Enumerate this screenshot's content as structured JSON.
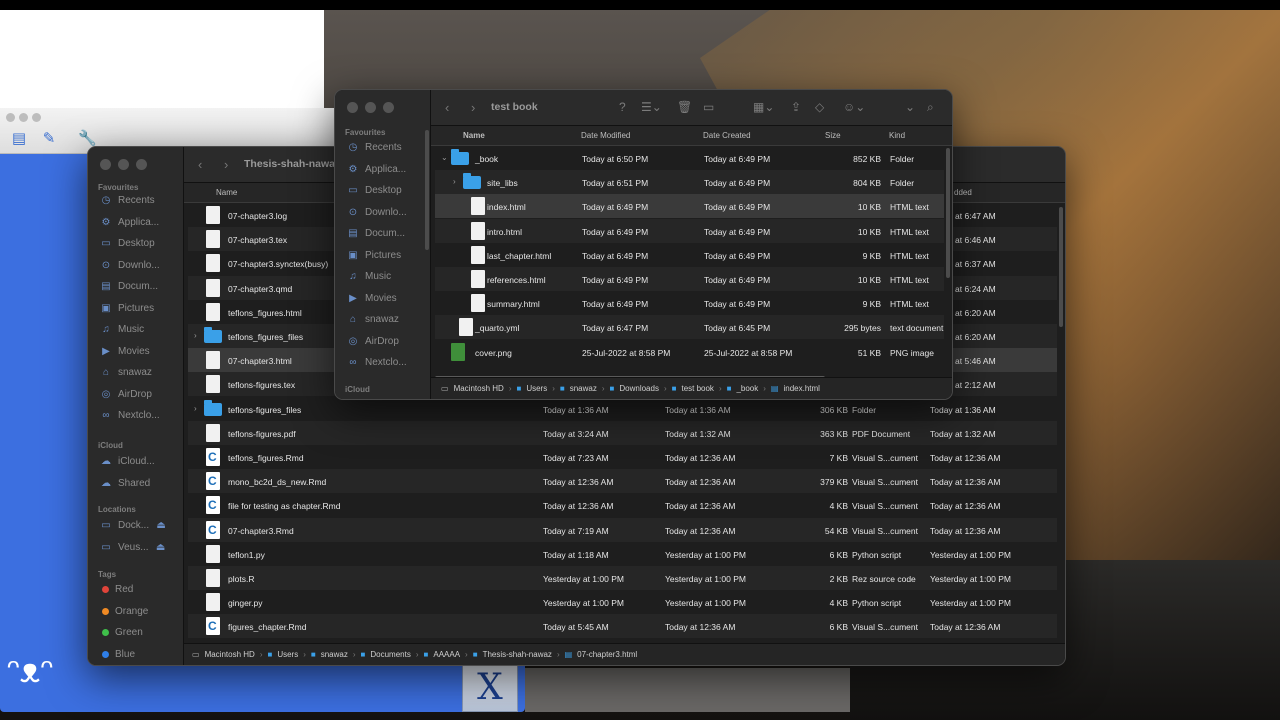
{
  "back_window": {
    "title": "Thesis-shah-nawaz",
    "columns": {
      "name": "Name",
      "date_added": "dded"
    },
    "sidebar": {
      "favourites_label": "Favourites",
      "favourites": [
        "Recents",
        "Applica...",
        "Desktop",
        "Downlo...",
        "Docum...",
        "Pictures",
        "Music",
        "Movies",
        "snawaz",
        "AirDrop",
        "Nextclo..."
      ],
      "icloud_label": "iCloud",
      "icloud": [
        "iCloud...",
        "Shared"
      ],
      "locations_label": "Locations",
      "locations": [
        "Dock...",
        "Veus..."
      ],
      "tags_label": "Tags",
      "tags": [
        {
          "name": "Red",
          "color": "#e0443a"
        },
        {
          "name": "Orange",
          "color": "#f08a24"
        },
        {
          "name": "Green",
          "color": "#3fbf4a"
        },
        {
          "name": "Blue",
          "color": "#2f7fe8"
        }
      ]
    },
    "rows": [
      {
        "name": "07-chapter3.log",
        "modified": "",
        "created": "",
        "size": "",
        "kind": "",
        "added": "Today at 6:47 AM",
        "icon": "doc"
      },
      {
        "name": "07-chapter3.tex",
        "modified": "",
        "created": "",
        "size": "",
        "kind": "",
        "added": "Today at 6:46 AM",
        "icon": "doc"
      },
      {
        "name": "07-chapter3.synctex(busy)",
        "modified": "",
        "created": "",
        "size": "",
        "kind": "",
        "added": "Today at 6:37 AM",
        "icon": "doc"
      },
      {
        "name": "07-chapter3.qmd",
        "modified": "",
        "created": "",
        "size": "",
        "kind": "",
        "added": "Today at 6:24 AM",
        "icon": "doc"
      },
      {
        "name": "teflons_figures.html",
        "modified": "",
        "created": "",
        "size": "",
        "kind": "",
        "added": "Today at 6:20 AM",
        "icon": "doc"
      },
      {
        "name": "teflons_figures_files",
        "modified": "",
        "created": "",
        "size": "",
        "kind": "",
        "added": "Today at 6:20 AM",
        "icon": "folder"
      },
      {
        "name": "07-chapter3.html",
        "modified": "",
        "created": "",
        "size": "",
        "kind": "",
        "added": "Today at 5:46 AM",
        "icon": "doc"
      },
      {
        "name": "teflons-figures.tex",
        "modified": "",
        "created": "",
        "size": "",
        "kind": "",
        "added": "Today at 2:12 AM",
        "icon": "doc"
      },
      {
        "name": "teflons-figures_files",
        "modified": "Today at 1:36 AM",
        "created": "Today at 1:36 AM",
        "size": "306 KB",
        "kind": "Folder",
        "added": "Today at 1:36 AM",
        "icon": "folder"
      },
      {
        "name": "teflons-figures.pdf",
        "modified": "Today at 3:24 AM",
        "created": "Today at 1:32 AM",
        "size": "363 KB",
        "kind": "PDF Document",
        "added": "Today at 1:32 AM",
        "icon": "doc"
      },
      {
        "name": "teflons_figures.Rmd",
        "modified": "Today at 7:23 AM",
        "created": "Today at 12:36 AM",
        "size": "7 KB",
        "kind": "Visual S...cument",
        "added": "Today at 12:36 AM",
        "icon": "c"
      },
      {
        "name": "mono_bc2d_ds_new.Rmd",
        "modified": "Today at 12:36 AM",
        "created": "Today at 12:36 AM",
        "size": "379 KB",
        "kind": "Visual S...cument",
        "added": "Today at 12:36 AM",
        "icon": "c"
      },
      {
        "name": "file for testing as chapter.Rmd",
        "modified": "Today at 12:36 AM",
        "created": "Today at 12:36 AM",
        "size": "4 KB",
        "kind": "Visual S...cument",
        "added": "Today at 12:36 AM",
        "icon": "c"
      },
      {
        "name": "07-chapter3.Rmd",
        "modified": "Today at 7:19 AM",
        "created": "Today at 12:36 AM",
        "size": "54 KB",
        "kind": "Visual S...cument",
        "added": "Today at 12:36 AM",
        "icon": "c"
      },
      {
        "name": "teflon1.py",
        "modified": "Today at 1:18 AM",
        "created": "Yesterday at 1:00 PM",
        "size": "6 KB",
        "kind": "Python script",
        "added": "Yesterday at 1:00 PM",
        "icon": "doc"
      },
      {
        "name": "plots.R",
        "modified": "Yesterday at 1:00 PM",
        "created": "Yesterday at 1:00 PM",
        "size": "2 KB",
        "kind": "Rez source code",
        "added": "Yesterday at 1:00 PM",
        "icon": "doc"
      },
      {
        "name": "ginger.py",
        "modified": "Yesterday at 1:00 PM",
        "created": "Yesterday at 1:00 PM",
        "size": "4 KB",
        "kind": "Python script",
        "added": "Yesterday at 1:00 PM",
        "icon": "doc"
      },
      {
        "name": "figures_chapter.Rmd",
        "modified": "Today at 5:45 AM",
        "created": "Today at 12:36 AM",
        "size": "6 KB",
        "kind": "Visual S...cument",
        "added": "Today at 12:36 AM",
        "icon": "c"
      }
    ],
    "path": [
      "Macintosh HD",
      "Users",
      "snawaz",
      "Documents",
      "AAAAA",
      "Thesis-shah-nawaz",
      "07-chapter3.html"
    ]
  },
  "front_window": {
    "title": "test book",
    "columns": {
      "name": "Name",
      "modified": "Date Modified",
      "created": "Date Created",
      "size": "Size",
      "kind": "Kind"
    },
    "sidebar": {
      "favourites_label": "Favourites",
      "favourites": [
        "Recents",
        "Applica...",
        "Desktop",
        "Downlo...",
        "Docum...",
        "Pictures",
        "Music",
        "Movies",
        "snawaz",
        "AirDrop",
        "Nextclo..."
      ],
      "icloud_label": "iCloud"
    },
    "rows": [
      {
        "name": "_book",
        "modified": "Today at 6:50 PM",
        "created": "Today at 6:49 PM",
        "size": "852 KB",
        "kind": "Folder",
        "icon": "folder",
        "indent": 0,
        "disclosure": "⌄"
      },
      {
        "name": "site_libs",
        "modified": "Today at 6:51 PM",
        "created": "Today at 6:49 PM",
        "size": "804 KB",
        "kind": "Folder",
        "icon": "folder",
        "indent": 1,
        "disclosure": "›"
      },
      {
        "name": "index.html",
        "modified": "Today at 6:49 PM",
        "created": "Today at 6:49 PM",
        "size": "10 KB",
        "kind": "HTML text",
        "icon": "doc",
        "indent": 1,
        "disclosure": ""
      },
      {
        "name": "intro.html",
        "modified": "Today at 6:49 PM",
        "created": "Today at 6:49 PM",
        "size": "10 KB",
        "kind": "HTML text",
        "icon": "doc",
        "indent": 1,
        "disclosure": ""
      },
      {
        "name": "last_chapter.html",
        "modified": "Today at 6:49 PM",
        "created": "Today at 6:49 PM",
        "size": "9 KB",
        "kind": "HTML text",
        "icon": "doc",
        "indent": 1,
        "disclosure": ""
      },
      {
        "name": "references.html",
        "modified": "Today at 6:49 PM",
        "created": "Today at 6:49 PM",
        "size": "10 KB",
        "kind": "HTML text",
        "icon": "doc",
        "indent": 1,
        "disclosure": ""
      },
      {
        "name": "summary.html",
        "modified": "Today at 6:49 PM",
        "created": "Today at 6:49 PM",
        "size": "9 KB",
        "kind": "HTML text",
        "icon": "doc",
        "indent": 1,
        "disclosure": ""
      },
      {
        "name": "_quarto.yml",
        "modified": "Today at 6:47 PM",
        "created": "Today at 6:45 PM",
        "size": "295 bytes",
        "kind": "text document",
        "icon": "doc",
        "indent": 0,
        "disclosure": ""
      },
      {
        "name": "cover.png",
        "modified": "25-Jul-2022 at 8:58 PM",
        "created": "25-Jul-2022 at 8:58 PM",
        "size": "51 KB",
        "kind": "PNG image",
        "icon": "png",
        "indent": 0,
        "disclosure": ""
      }
    ],
    "path": [
      "Macintosh HD",
      "Users",
      "snawaz",
      "Downloads",
      "test book",
      "_book",
      "index.html"
    ]
  },
  "colors": {
    "accent": "#3aa0e8",
    "desktop_blue": "#3c6fe0"
  }
}
